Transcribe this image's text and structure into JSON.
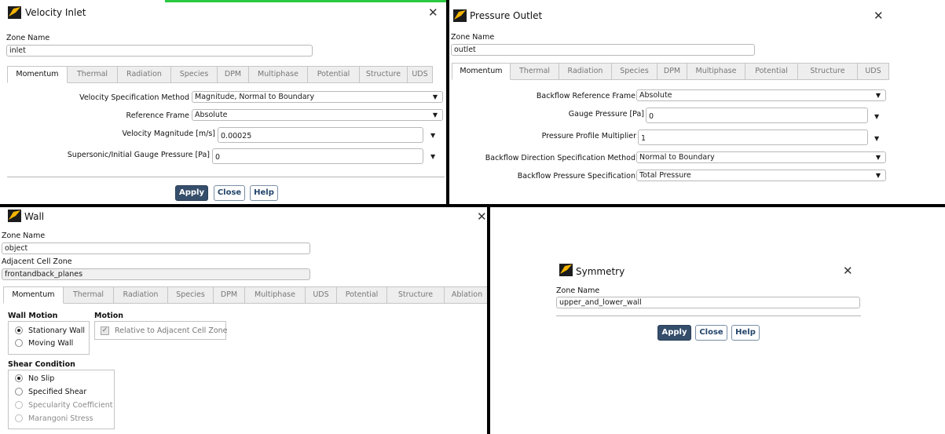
{
  "velocity_inlet": {
    "title": "Velocity Inlet",
    "zone_name_label": "Zone Name",
    "zone_name_value": "inlet",
    "tabs": [
      "Momentum",
      "Thermal",
      "Radiation",
      "Species",
      "DPM",
      "Multiphase",
      "Potential",
      "Structure",
      "UDS"
    ],
    "velocity_spec_label": "Velocity Specification Method",
    "velocity_spec_value": "Magnitude, Normal to Boundary",
    "reference_frame_label": "Reference Frame",
    "reference_frame_value": "Absolute",
    "velocity_magnitude_label": "Velocity Magnitude [m/s]",
    "velocity_magnitude_value": "0.00025",
    "gauge_pressure_label": "Supersonic/Initial Gauge Pressure [Pa]",
    "gauge_pressure_value": "0",
    "apply_label": "Apply",
    "close_label": "Close",
    "help_label": "Help"
  },
  "pressure_outlet": {
    "title": "Pressure Outlet",
    "zone_name_label": "Zone Name",
    "zone_name_value": "outlet",
    "tabs": [
      "Momentum",
      "Thermal",
      "Radiation",
      "Species",
      "DPM",
      "Multiphase",
      "Potential",
      "Structure",
      "UDS"
    ],
    "backflow_ref_label": "Backflow Reference Frame",
    "backflow_ref_value": "Absolute",
    "gauge_pressure_label": "Gauge Pressure [Pa]",
    "gauge_pressure_value": "0",
    "profile_mult_label": "Pressure Profile Multiplier",
    "profile_mult_value": "1",
    "backflow_dir_label": "Backflow Direction Specification Method",
    "backflow_dir_value": "Normal to Boundary",
    "backflow_pressure_label": "Backflow Pressure Specification",
    "backflow_pressure_value": "Total Pressure"
  },
  "wall": {
    "title": "Wall",
    "zone_name_label": "Zone Name",
    "zone_name_value": "object",
    "adjacent_label": "Adjacent Cell Zone",
    "adjacent_value": "frontandback_planes",
    "tabs": [
      "Momentum",
      "Thermal",
      "Radiation",
      "Species",
      "DPM",
      "Multiphase",
      "UDS",
      "Potential",
      "Structure",
      "Ablation"
    ],
    "wall_motion_label": "Wall Motion",
    "stationary_label": "Stationary Wall",
    "moving_label": "Moving Wall",
    "motion_label": "Motion",
    "relative_label": "Relative to Adjacent Cell Zone",
    "shear_label": "Shear Condition",
    "no_slip_label": "No Slip",
    "specified_shear_label": "Specified Shear",
    "specularity_label": "Specularity Coefficient",
    "marangoni_label": "Marangoni Stress"
  },
  "symmetry": {
    "title": "Symmetry",
    "zone_name_label": "Zone Name",
    "zone_name_value": "upper_and_lower_wall",
    "apply_label": "Apply",
    "close_label": "Close",
    "help_label": "Help"
  },
  "icons": {
    "close": "close-icon",
    "logo": "ansys-logo-icon",
    "dropdown": "chevron-down-icon"
  },
  "colors": {
    "apply_bg": "#354e6b",
    "button_text": "#23456b",
    "divider": "#000000",
    "accent_line": "#2ac940"
  }
}
